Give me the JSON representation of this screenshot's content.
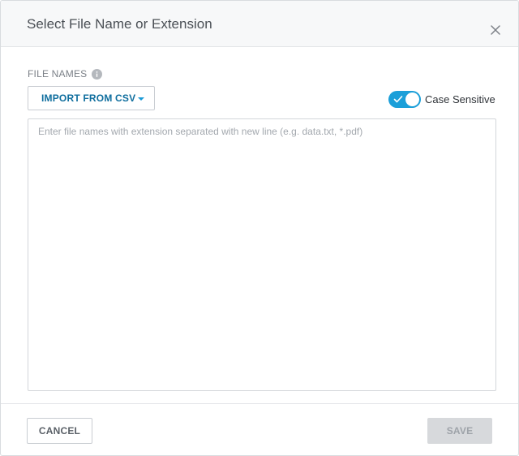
{
  "dialog": {
    "title": "Select File Name or Extension"
  },
  "file_names": {
    "label": "FILE NAMES",
    "import_button_label": "IMPORT FROM CSV",
    "textarea_placeholder": "Enter file names with extension separated with new line (e.g. data.txt, *.pdf)",
    "textarea_value": ""
  },
  "case_sensitive": {
    "label": "Case Sensitive",
    "enabled": true
  },
  "footer": {
    "cancel_label": "CANCEL",
    "save_label": "SAVE",
    "save_disabled": true
  },
  "icons": {
    "close": "close-icon",
    "info": "info-icon",
    "caret": "caret-down-icon",
    "check": "check-icon"
  },
  "colors": {
    "accent": "#1b9fd9",
    "button_text": "#0f6e9e",
    "disabled_bg": "#d7d9dc",
    "disabled_text": "#9ea3a9"
  }
}
